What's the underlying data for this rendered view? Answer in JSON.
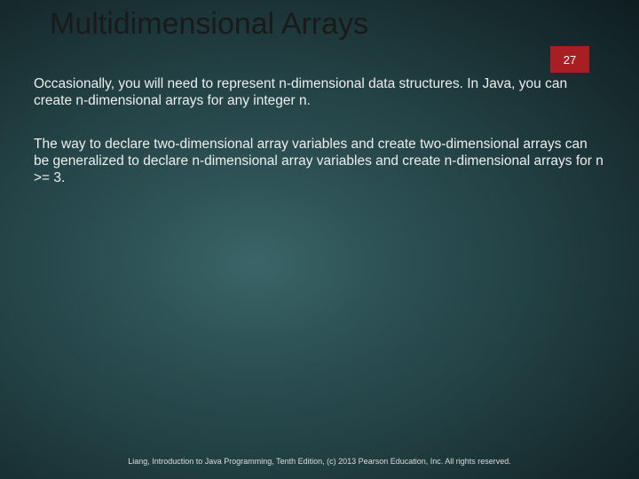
{
  "header": {
    "title": "Multidimensional Arrays",
    "page_number": "27"
  },
  "body": {
    "paragraph1": "Occasionally, you will need to represent n-dimensional data structures. In Java, you can create n-dimensional arrays for any integer n.",
    "paragraph2": "The way to declare two-dimensional array variables and create two-dimensional arrays can be generalized to declare n-dimensional array variables and create n-dimensional arrays for n >= 3."
  },
  "footer": {
    "text": "Liang, Introduction to Java Programming, Tenth Edition, (c) 2013 Pearson Education, Inc. All rights reserved."
  }
}
